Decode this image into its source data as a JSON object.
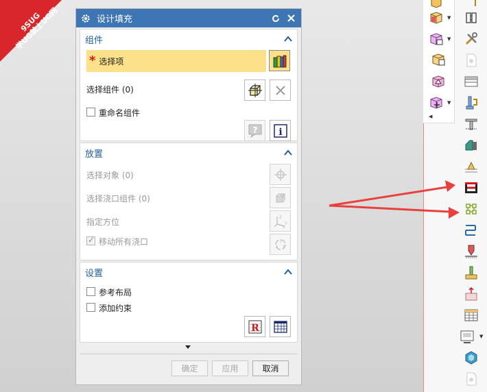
{
  "watermark": {
    "line1": "9SUG",
    "line2": "学UG就上UG网"
  },
  "dialog": {
    "title": "设计填充",
    "sections": {
      "components": {
        "heading": "组件",
        "select_item": "选择项",
        "select_component": "选择组件 (0)",
        "rename_component": "重命名组件"
      },
      "placement": {
        "heading": "放置",
        "select_object": "选择对象 (0)",
        "select_gate_component": "选择浇口组件 (0)",
        "specify_orientation": "指定方位",
        "move_all_gates": "移动所有浇口",
        "move_all_gates_checked": true
      },
      "settings": {
        "heading": "设置",
        "reference_layout": "参考布局",
        "add_constraint": "添加约束"
      }
    },
    "buttons": {
      "ok": "确定",
      "apply": "应用",
      "cancel": "取消"
    }
  },
  "colors": {
    "title_bar": "#3e75b5",
    "section_heading": "#1f5e9c",
    "highlight": "#fde08a",
    "required_star": "#d4161b",
    "arrow": "#e8413d"
  }
}
